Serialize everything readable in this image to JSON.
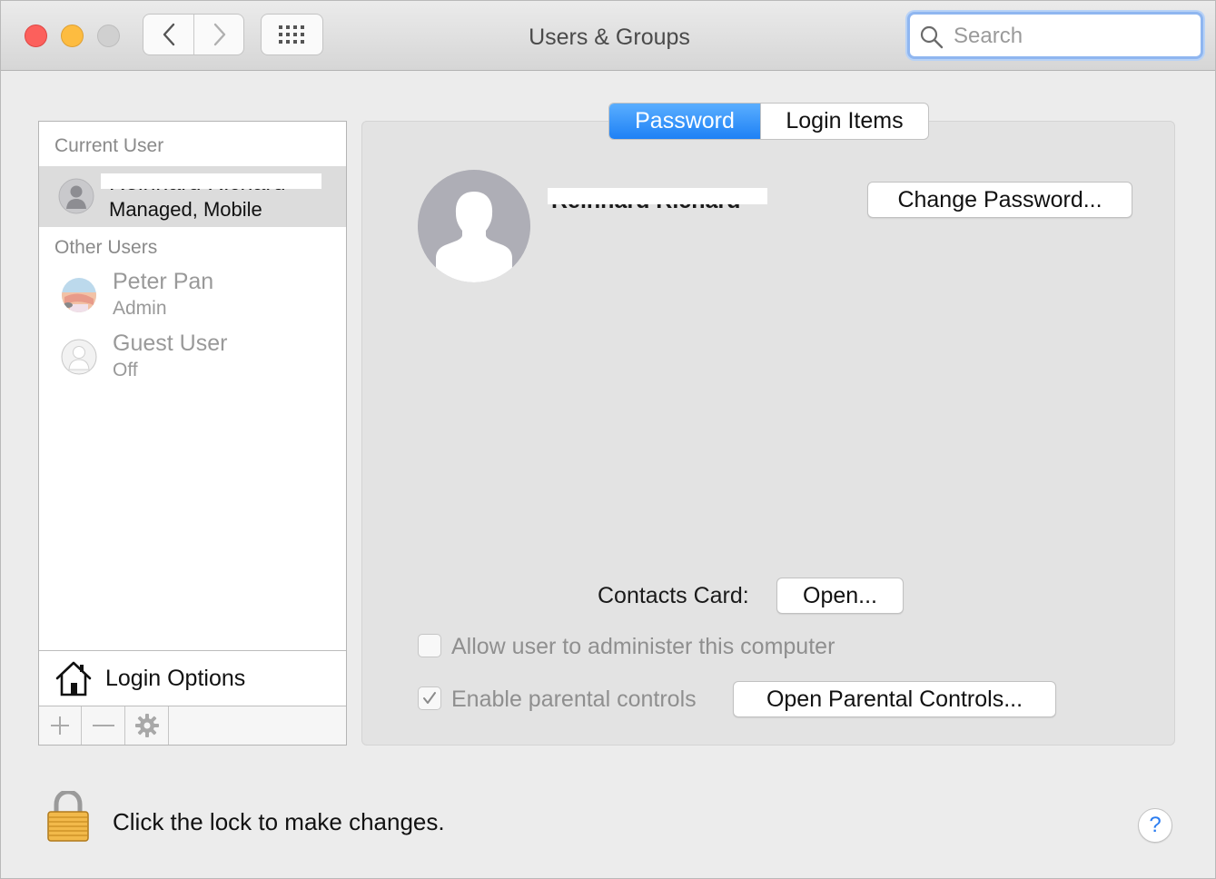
{
  "window": {
    "title": "Users & Groups",
    "search_placeholder": "Search"
  },
  "sidebar": {
    "current_user_label": "Current User",
    "current_user": {
      "name": "Reinhard Richard",
      "role": "Managed, Mobile"
    },
    "other_users_label": "Other Users",
    "other_users": [
      {
        "name": "Peter Pan",
        "role": "Admin"
      },
      {
        "name": "Guest User",
        "role": "Off"
      }
    ],
    "login_options_label": "Login Options",
    "toolbar": {
      "add": "+",
      "remove": "—"
    }
  },
  "tabs": [
    {
      "label": "Password",
      "active": true
    },
    {
      "label": "Login Items",
      "active": false
    }
  ],
  "main": {
    "user_full_name": "Reinhard Richard",
    "change_password_label": "Change Password...",
    "contacts_card_label": "Contacts Card:",
    "contacts_open_label": "Open...",
    "allow_admin_label": "Allow user to administer this computer",
    "allow_admin_checked": false,
    "parental_controls_label": "Enable parental controls",
    "parental_controls_checked": true,
    "open_parental_label": "Open Parental Controls..."
  },
  "footer": {
    "lock_message": "Click the lock to make changes.",
    "help_label": "?"
  },
  "colors": {
    "accent": "#1e81f5",
    "close": "#fc605c",
    "minimize": "#fdbc40",
    "zoom": "#d0d0d0"
  }
}
